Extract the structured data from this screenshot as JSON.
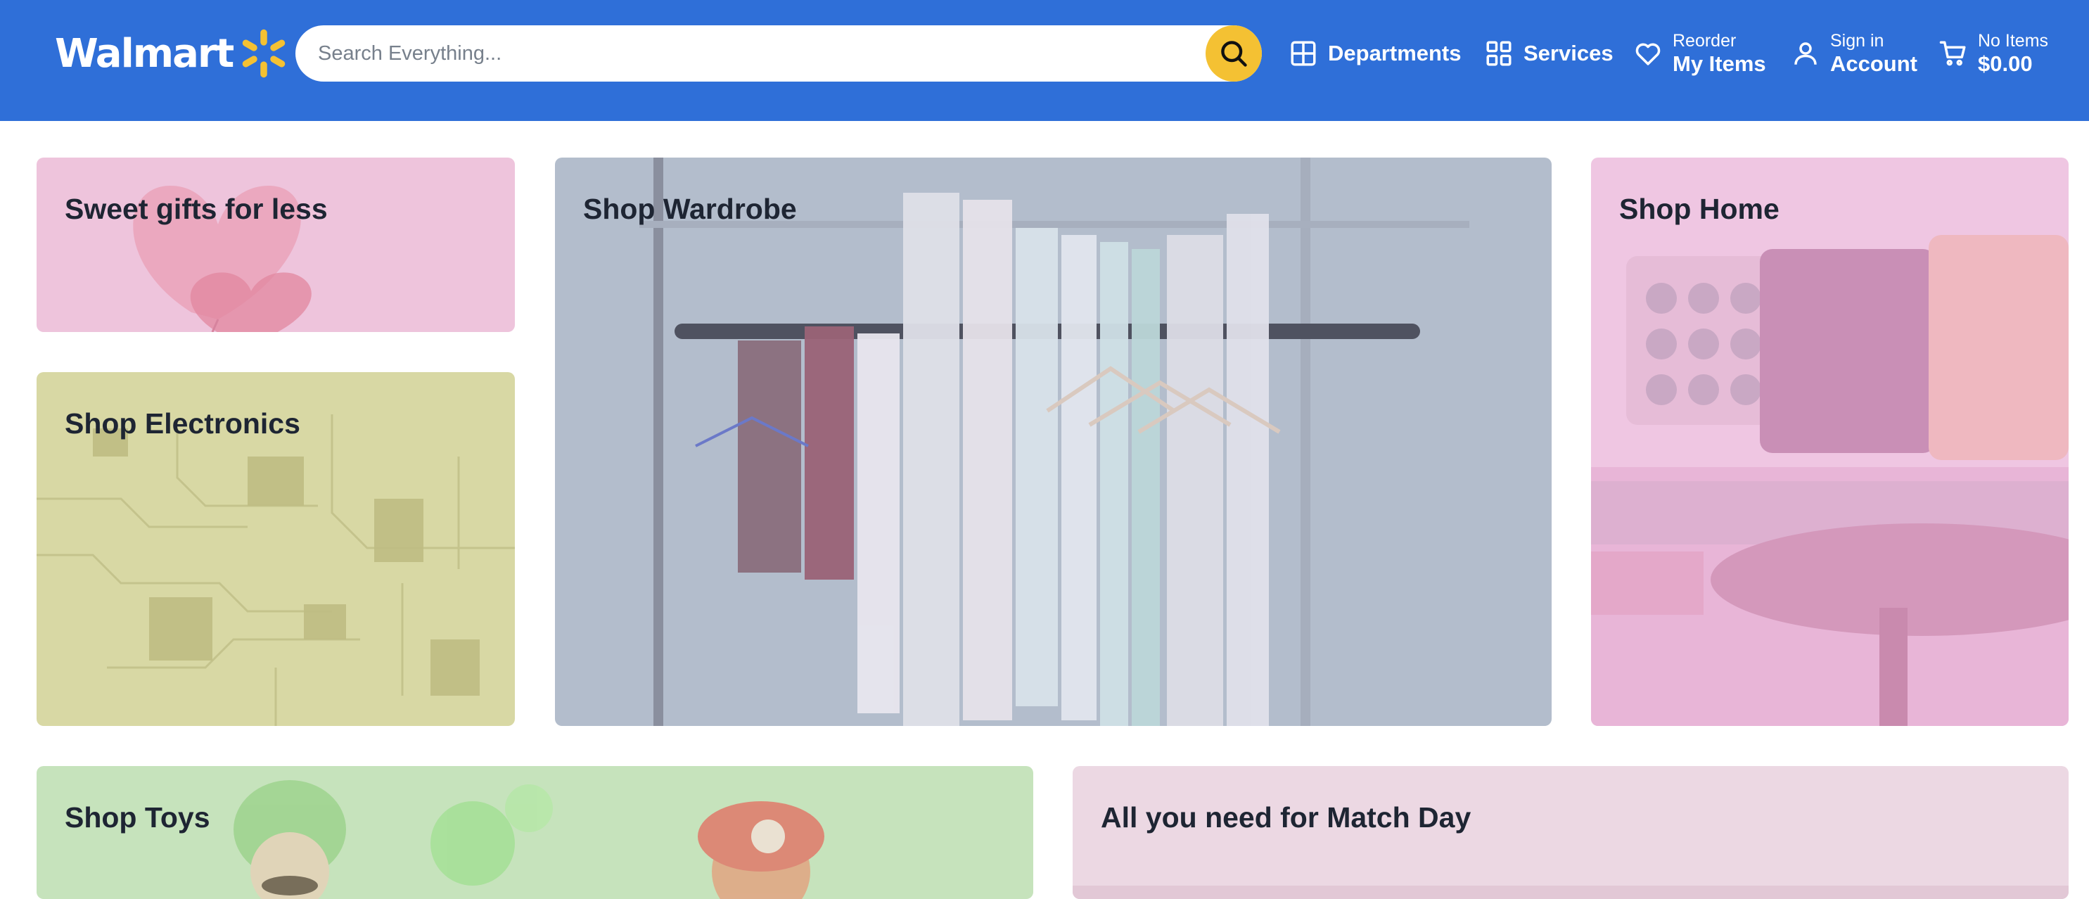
{
  "header": {
    "logo_text": "Walmart",
    "search_placeholder": "Search Everything...",
    "nav": {
      "departments": "Departments",
      "services": "Services",
      "reorder_small": "Reorder",
      "reorder_big": "My Items",
      "signin_small": "Sign in",
      "signin_big": "Account",
      "cart_small": "No Items",
      "cart_big": "$0.00"
    },
    "colors": {
      "bar": "#2f6fd8",
      "spark": "#f4c133",
      "search_button": "#f4c133"
    }
  },
  "cards": {
    "gifts": {
      "title": "Sweet gifts for less"
    },
    "wardrobe": {
      "title": "Shop Wardrobe"
    },
    "home": {
      "title": "Shop Home"
    },
    "electronics": {
      "title": "Shop Electronics"
    },
    "toys": {
      "title": "Shop Toys"
    },
    "matchday": {
      "title": "All you need for Match Day"
    }
  }
}
